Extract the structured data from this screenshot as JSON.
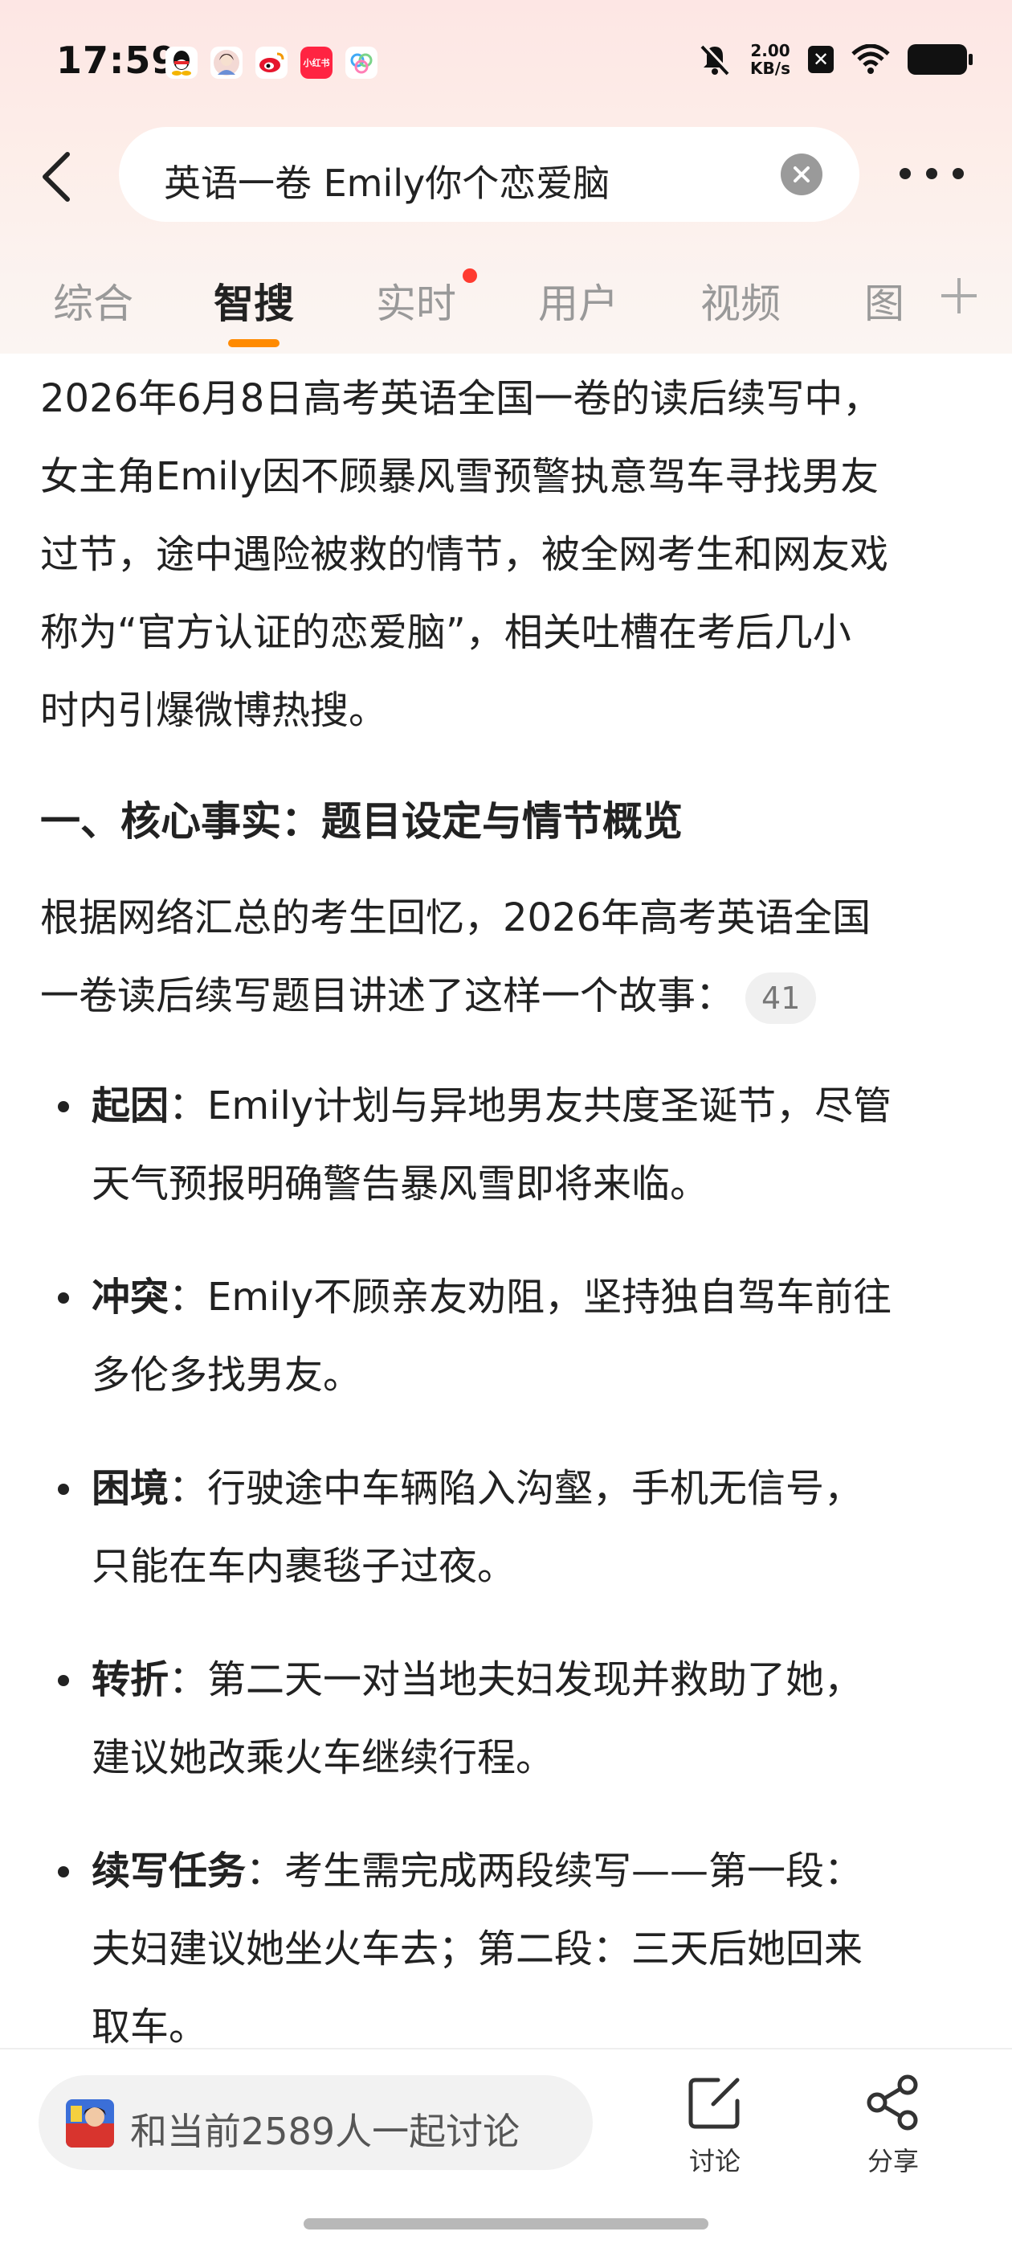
{
  "status_bar": {
    "time": "17:59",
    "app_icons": [
      "qq-icon",
      "avatar-app-icon",
      "weibo-icon",
      "xiaohongshu-icon",
      "cloud-app-icon"
    ],
    "xiaohongshu_label": "小红书",
    "net_speed_value": "2.00",
    "net_speed_unit": "KB/s"
  },
  "search": {
    "query": "英语一卷 Emily你个恋爱脑"
  },
  "tabs": [
    {
      "label": "综合",
      "active": false
    },
    {
      "label": "智搜",
      "active": true
    },
    {
      "label": "实时",
      "active": false,
      "has_dot": true
    },
    {
      "label": "用户",
      "active": false
    },
    {
      "label": "视频",
      "active": false
    },
    {
      "label": "图",
      "active": false
    }
  ],
  "content": {
    "intro_lines": [
      "2026年6月8日高考英语全国一卷的读后续写中，",
      "女主角Emily因不顾暴风雪预警执意驾车寻找男友",
      "过节，途中遇险被救的情节，被全网考生和网友戏",
      "称为“官方认证的恋爱脑”，相关吐槽在考后几小",
      "时内引爆微博热搜。"
    ],
    "heading": "一、核心事实：题目设定与情节概览",
    "lead_lines": [
      "根据网络汇总的考生回忆，2026年高考英语全国",
      "一卷读后续写题目讲述了这样一个故事："
    ],
    "citation": "41",
    "bullets": [
      {
        "term": "起因",
        "lines": [
          "：Emily计划与异地男友共度圣诞节，尽管",
          "天气预报明确警告暴风雪即将来临。"
        ]
      },
      {
        "term": "冲突",
        "lines": [
          "：Emily不顾亲友劝阻，坚持独自驾车前往",
          "多伦多找男友。"
        ]
      },
      {
        "term": "困境",
        "lines": [
          "：行驶途中车辆陷入沟壑，手机无信号，",
          "只能在车内裹毯子过夜。"
        ]
      },
      {
        "term": "转折",
        "lines": [
          "：第二天一对当地夫妇发现并救助了她，",
          "建议她改乘火车继续行程。"
        ]
      },
      {
        "term": "续写任务",
        "lines": [
          "：考生需完成两段续写——第一段：",
          "夫妇建议她坐火车去；第二段：三天后她回来",
          "取车。"
        ]
      }
    ]
  },
  "bottom_bar": {
    "discuss_text": "和当前2589人一起讨论",
    "comment_label": "讨论",
    "share_label": "分享"
  },
  "colors": {
    "accent": "#ff8a00",
    "dot": "#ff3b30",
    "header_gradient_top": "#fde6e4"
  }
}
